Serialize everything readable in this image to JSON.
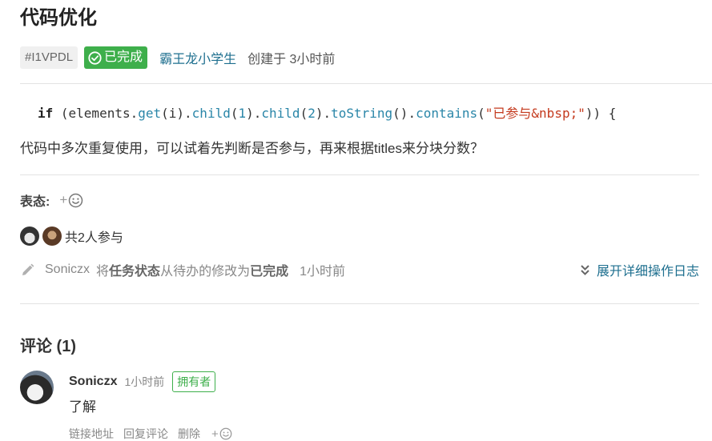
{
  "issue": {
    "title": "代码优化",
    "id": "#I1VPDL",
    "status": "已完成",
    "author": "霸王龙小学生",
    "created": "创建于 3小时前"
  },
  "description": {
    "code": {
      "kw": "if",
      "t1": " (elements.",
      "get": "get",
      "t2": "(i).",
      "child1": "child",
      "t3": "(",
      "n1": "1",
      "t4": ").",
      "child2": "child",
      "t5": "(",
      "n2": "2",
      "t6": ").",
      "tostring": "toString",
      "t7": "().",
      "contains": "contains",
      "t8": "(",
      "str": "\"已参与&nbsp;\"",
      "t9": ")) {"
    },
    "text": "代码中多次重复使用，可以试着先判断是否参与，再来根据titles来分块分数？"
  },
  "reactions": {
    "label": "表态:",
    "add": "+"
  },
  "participants": {
    "label": "共2人参与"
  },
  "log": {
    "user": "Soniczx",
    "prefix": "将",
    "field": "任务状态",
    "middle": "从待办的修改为",
    "value": "已完成",
    "time": "1小时前",
    "expand": "展开详细操作日志"
  },
  "comments": {
    "title": "评论 (1)",
    "items": [
      {
        "user": "Soniczx",
        "time": "1小时前",
        "badge": "拥有者",
        "body": "了解",
        "actions": {
          "link": "链接地址",
          "reply": "回复评论",
          "delete": "删除",
          "add": "+"
        }
      }
    ]
  },
  "colors": {
    "status_green": "#3eaf4b",
    "link_blue": "#1e6f8f"
  },
  "icons": {
    "status": "check-circle-icon",
    "emoji": "smiley-icon",
    "log": "pencil-icon",
    "expand": "double-chevron-down-icon"
  }
}
